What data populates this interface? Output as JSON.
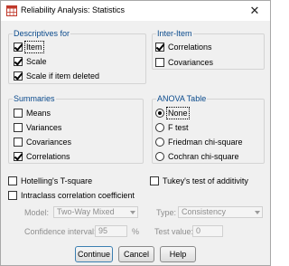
{
  "window": {
    "title": "Reliability Analysis: Statistics",
    "close_glyph": "✕"
  },
  "descriptives": {
    "legend": "Descriptives for",
    "item": "Item",
    "scale": "Scale",
    "scale_deleted": "Scale if item deleted"
  },
  "inter_item": {
    "legend": "Inter-Item",
    "correlations": "Correlations",
    "covariances": "Covariances"
  },
  "summaries": {
    "legend": "Summaries",
    "means": "Means",
    "variances": "Variances",
    "covariances": "Covariances",
    "correlations": "Correlations"
  },
  "anova": {
    "legend": "ANOVA Table",
    "none": "None",
    "f_test": "F test",
    "friedman": "Friedman chi-square",
    "cochran": "Cochran chi-square"
  },
  "options": {
    "hotelling": "Hotelling's T-square",
    "tukey": "Tukey's test of additivity",
    "intraclass": "Intraclass correlation coefficient"
  },
  "icc": {
    "model_label": "Model:",
    "model_value": "Two-Way Mixed",
    "type_label": "Type:",
    "type_value": "Consistency",
    "ci_label": "Confidence interval:",
    "ci_value": "95",
    "ci_unit": "%",
    "test_label": "Test value:",
    "test_value": "0"
  },
  "buttons": {
    "continue": "Continue",
    "cancel": "Cancel",
    "help": "Help"
  },
  "icons": {
    "app": "spss-table-icon",
    "close": "close-icon"
  }
}
